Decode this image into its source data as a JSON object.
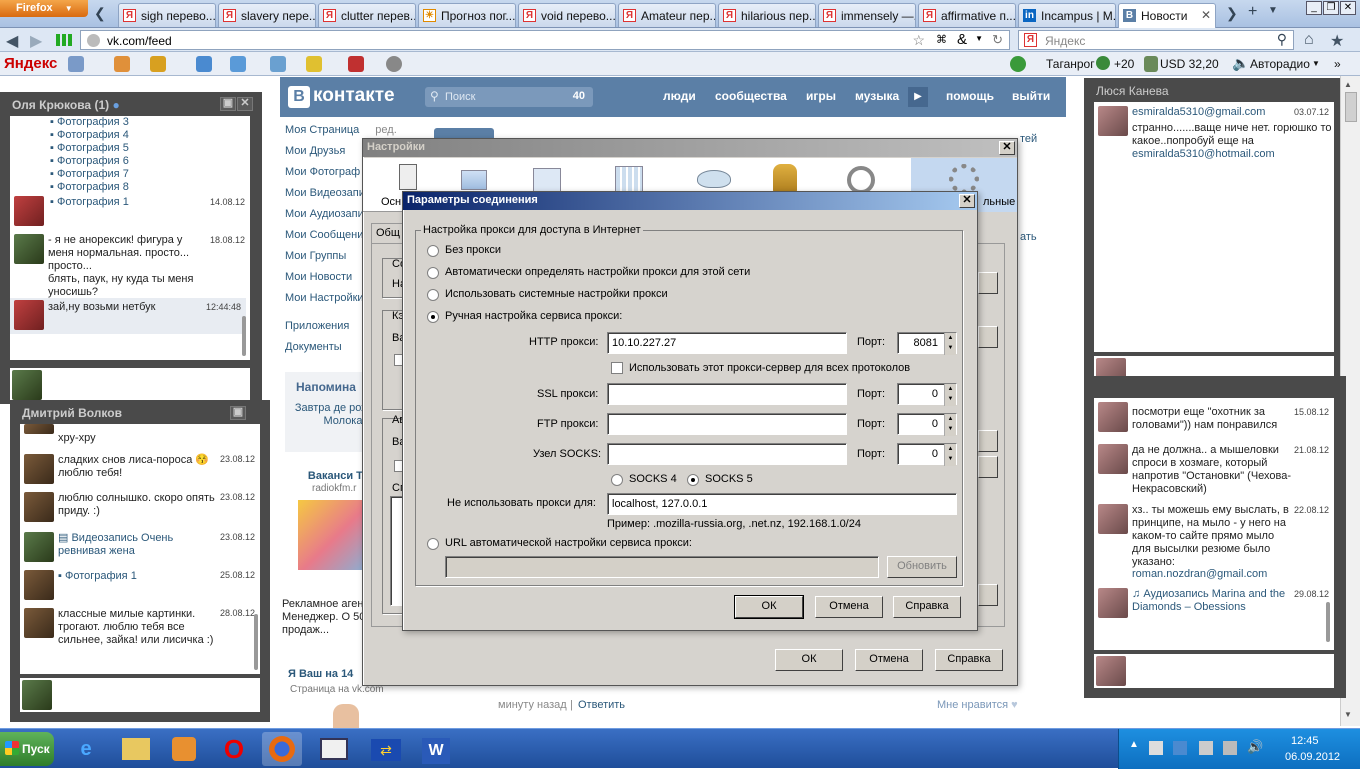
{
  "browser": {
    "menu_button": "Firefox",
    "tabs": [
      {
        "label": "sigh перево..."
      },
      {
        "label": "slavery пере..."
      },
      {
        "label": "clutter перев..."
      },
      {
        "label": "Прогноз пог..."
      },
      {
        "label": "void перево..."
      },
      {
        "label": "Amateur пер..."
      },
      {
        "label": "hilarious пер..."
      },
      {
        "label": "immensely —..."
      },
      {
        "label": "affirmative п..."
      },
      {
        "label": "Incampus | M..."
      },
      {
        "label": "Новости"
      }
    ],
    "url": "vk.com/feed",
    "search_placeholder": "Яндекс"
  },
  "yandex_bar": {
    "logo": "Яндекс",
    "weather": "+20",
    "city": "Таганрог",
    "currency": "USD 32,20",
    "radio": "Авторадио"
  },
  "vk": {
    "logo": "контакте",
    "logo_letter": "В",
    "search_placeholder": "Поиск",
    "search_count": "40",
    "menu": [
      "люди",
      "сообщества",
      "игры",
      "музыка",
      "помощь",
      "выйти"
    ],
    "left_menu": [
      "Моя Страница",
      "Мои Друзья",
      "Мои Фотограф",
      "Мои Видеозапи",
      "Мои Аудиозапи",
      "Мои Сообщени",
      "Мои Группы",
      "Мои Новости",
      "Мои Настройки"
    ],
    "left_menu_extra": [
      "Приложения",
      "Документы"
    ],
    "edit_label": "ред.",
    "reminder_title": "Напомина",
    "reminder_text": "Завтра де рождения Т Молоканов",
    "ad1_title": "Ваканси Таганрог",
    "ad1_site": "radiokfm.r",
    "ad1_text": "Рекламное аген Менеджер. О 5000, бонус продаж...",
    "ad2_title": "Я Ваш на 14",
    "ad2_sub": "Страница на vk.com",
    "post_time": "минуту назад",
    "reply": "Ответить",
    "like": "Мне нравится",
    "right_tab_1": "тей",
    "right_tab_2": "ать"
  },
  "chat_left_top": {
    "title": "Оля Крюкова (1)",
    "photos": [
      "Фотография 3",
      "Фотография 4",
      "Фотография 5",
      "Фотография 6",
      "Фотография 7",
      "Фотография 8"
    ],
    "messages": [
      {
        "text": "Фотография 1",
        "date": "14.08.12"
      },
      {
        "text": "- я не анорексик! фигура у меня нормальная. просто... просто...\nблять, паук, ну куда ты меня уносишь?",
        "date": "18.08.12"
      },
      {
        "text": "зай,ну возьми нетбук",
        "date": "12:44:48"
      }
    ]
  },
  "chat_left_bottom": {
    "title": "Дмитрий Волков",
    "messages": [
      {
        "text": "хру-хру",
        "date": ""
      },
      {
        "text": "сладких снов лиса-пороса 😚 люблю тебя!",
        "date": "23.08.12"
      },
      {
        "text": "люблю солнышко. скоро опять приду. :)",
        "date": "23.08.12"
      },
      {
        "text": "Видеозапись Очень ревнивая жена",
        "date": "23.08.12"
      },
      {
        "text": "Фотография 1",
        "date": "25.08.12"
      },
      {
        "text": "классные милые картинки. трогают. люблю тебя все сильнее, зайка! или лисичка :)",
        "date": "28.08.12"
      }
    ]
  },
  "chat_right_top": {
    "title": "Люся Канева",
    "messages": [
      {
        "from": "esmiralda5310@gmail.com",
        "text": "странно.......ваще ниче нет. горюшко то какое..попробуй еще на",
        "link": "esmiralda5310@hotmail.com",
        "date": "03.07.12"
      }
    ]
  },
  "chat_right_bottom": {
    "messages": [
      {
        "text": "посмотри еще \"охотник за головами\")) нам понравился",
        "date": "15.08.12"
      },
      {
        "text": "да не должна.. а мышеловки спроси в хозмаге, который напротив \"Остановки\" (Чехова-Некрасовский)",
        "date": "21.08.12"
      },
      {
        "text": "хз.. ты можешь ему выслать, в принципе, на мыло - у него на каком-то сайте прямо мыло для высылки резюме было указано:",
        "link": "roman.nozdran@gmail.com",
        "date": "22.08.12"
      },
      {
        "text": "Аудиозапись Marina and the Diamonds – Obessions",
        "date": "29.08.12"
      }
    ]
  },
  "settings_dialog": {
    "title": "Настройки",
    "tab_left": "Осн",
    "tab_right": "льные",
    "subtab": "Общ",
    "ok": "ОК",
    "cancel": "Отмена",
    "help": "Справка",
    "frag": [
      "Со",
      "На",
      "Кэ",
      "Ва",
      "Ав",
      "Ва",
      "Сп"
    ]
  },
  "proxy_dialog": {
    "title": "Параметры соединения",
    "group_title": "Настройка прокси для доступа в Интернет",
    "options": {
      "no_proxy": "Без прокси",
      "auto_detect": "Автоматически определять настройки прокси для этой сети",
      "system": "Использовать системные настройки прокси",
      "manual": "Ручная настройка сервиса прокси:",
      "pac": "URL автоматической настройки сервиса прокси:"
    },
    "http_label": "HTTP прокси:",
    "http_value": "10.10.227.27",
    "port_label": "Порт:",
    "http_port": "8081",
    "use_all_label": "Использовать этот прокси-сервер для всех протоколов",
    "ssl_label": "SSL прокси:",
    "ssl_port": "0",
    "ftp_label": "FTP прокси:",
    "ftp_port": "0",
    "socks_label": "Узел SOCKS:",
    "socks_port": "0",
    "socks4": "SOCKS 4",
    "socks5": "SOCKS 5",
    "no_proxy_label": "Не использовать прокси для:",
    "no_proxy_value": "localhost, 127.0.0.1",
    "example": "Пример: .mozilla-russia.org, .net.nz, 192.168.1.0/24",
    "reload": "Обновить",
    "ok": "ОК",
    "cancel": "Отмена",
    "help": "Справка"
  },
  "taskbar": {
    "start": "Пуск",
    "lang": "RU",
    "time": "12:45",
    "date": "06.09.2012"
  }
}
